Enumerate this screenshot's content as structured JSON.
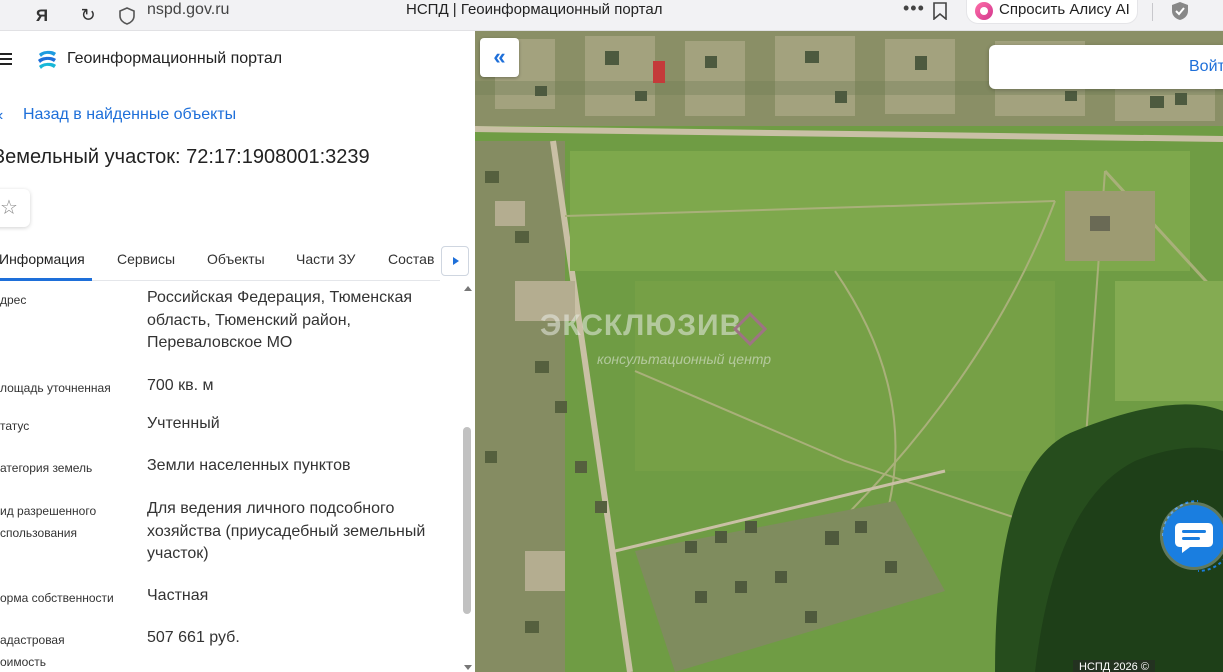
{
  "browser": {
    "url": "nspd.gov.ru",
    "tab_title": "НСПД | Геоинформационный портал",
    "alisa_label": "Спросить Алису AI",
    "more_dots": "•••"
  },
  "header": {
    "portal_name": "Геоинформационный портал"
  },
  "back_link": "Назад в найденные объекты",
  "object_title": "Земельный участок: 72:17:1908001:3239",
  "tabs": [
    {
      "label": "Информация",
      "active": true
    },
    {
      "label": "Сервисы",
      "active": false
    },
    {
      "label": "Объекты",
      "active": false
    },
    {
      "label": "Части ЗУ",
      "active": false
    },
    {
      "label": "Состав",
      "active": false
    }
  ],
  "properties": [
    {
      "label": "дрес",
      "value": "Российская Федерация, Тюменская область, Тюменский район, Переваловское МО"
    },
    {
      "label": "лощадь уточненная",
      "value": "700 кв. м"
    },
    {
      "label": "татус",
      "value": "Учтенный"
    },
    {
      "label": "атегория земель",
      "value": "Земли населенных пунктов"
    },
    {
      "label": "ид разрешенного спользования",
      "value": "Для ведения личного подсобного хозяйства (приусадебный земельный участок)"
    },
    {
      "label": "орма собственности",
      "value": "Частная"
    },
    {
      "label": "адастровая оимость",
      "value": "507 661 руб."
    }
  ],
  "map": {
    "login_label": "Войт",
    "watermark_main": "ЭКСКЛЮЗИВ",
    "watermark_sub": "консультационный центр",
    "copyright": "НСПД 2026 ©"
  },
  "colors": {
    "accent": "#1e6fd9",
    "chat": "#1a7ee0"
  }
}
